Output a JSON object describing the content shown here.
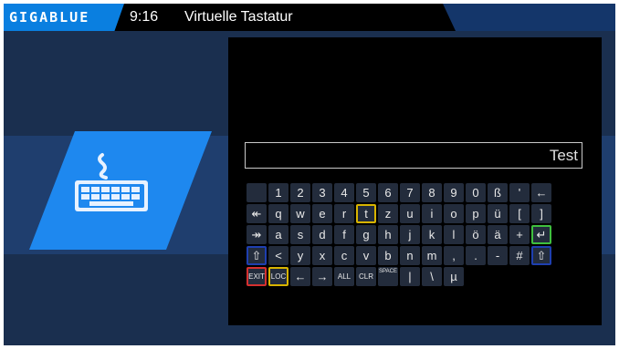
{
  "header": {
    "logo": "GIGABLUE",
    "clock": "9:16",
    "title": "Virtuelle Tastatur"
  },
  "icon": "keyboard-icon",
  "input": {
    "value": "Test"
  },
  "keyboard": {
    "rows": [
      [
        "",
        "1",
        "2",
        "3",
        "4",
        "5",
        "6",
        "7",
        "8",
        "9",
        "0",
        "ß",
        "'",
        "←"
      ],
      [
        "↞",
        "q",
        "w",
        "e",
        "r",
        "t",
        "z",
        "u",
        "i",
        "o",
        "p",
        "ü",
        "[",
        "]"
      ],
      [
        "↠",
        "a",
        "s",
        "d",
        "f",
        "g",
        "h",
        "j",
        "k",
        "l",
        "ö",
        "ä",
        "+",
        "↵"
      ],
      [
        "⇧",
        "<",
        "y",
        "x",
        "c",
        "v",
        "b",
        "n",
        "m",
        ",",
        ".",
        "-",
        "#",
        "⇧"
      ],
      [
        "EXIT",
        "LOC",
        "←",
        "→",
        "ALL",
        "CLR",
        "SPACE",
        "|",
        "\\",
        "µ"
      ]
    ]
  },
  "colors": {
    "background": "#1a2f4f",
    "accent": "#0a7fe0",
    "panel": "#000000",
    "key": "#232c3c",
    "focus": "#d8b400",
    "ok": "#3fbf3f",
    "exit": "#d63030",
    "shift": "#1e3fb0"
  }
}
